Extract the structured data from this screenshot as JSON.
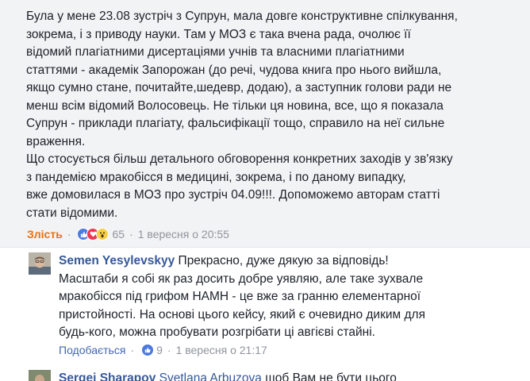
{
  "main_comment": {
    "lines": [
      "Була у мене 23.08 зустріч з Супрун, мала довге конструктивне спілкування,",
      "зокрема, і з приводу науки. Там у МОЗ є така вчена рада, очолює її",
      "відомий плагіатними дисертаціями учнів та власними плагіатними",
      "статтями - академік Запорожан (до речі, чудова книга про нього вийшла,",
      "якщо сумно стане, почитайте,шедевр, додаю), а заступник голови ради не",
      "менш всім відомий Волосовець. Не тільки ця новина, все, що я показала",
      "Супрун - приклади плагіату, фальсифікації тощо, справило на неї сильне",
      "враження.",
      "Що стосується більш детального обговорення конкретних заходів у зв'язку",
      "з пандемією мракобісся в медицині, зокрема, і по даному випадку,",
      "вже домовилася в МОЗ про зустріч 04.09!!!. Допоможемо авторам статті",
      "стати відомими."
    ],
    "action_label": "Злість",
    "separator": "·",
    "reaction_count": "65",
    "timestamp": "1 вересня о 20:55",
    "reaction_icons": [
      "like-icon",
      "love-icon",
      "wow-icon"
    ]
  },
  "reply": {
    "author": "Semen Yesylevskyy",
    "lines": [
      "Прекрасно, дуже дякую за відповідь!",
      "Масштаби я собі як раз досить добре уявляю, але таке зухвале",
      "мракобісся під грифом НАМН - це вже за гранню елементарної",
      "пристойності. На основі цього кейсу, який є очевидно диким для",
      "будь-кого, можна пробувати розгрібати ці авгієві стайні."
    ],
    "first_line_rest": "Прекрасно, дуже дякую за відповідь!",
    "action_label": "Подобається",
    "separator": "·",
    "reaction_count": "9",
    "timestamp": "1 вересня о 21:17"
  },
  "next_comment": {
    "author": "Sergei Sharapov",
    "tagged": "Svetlana Arbuzova",
    "text_start": " щоб Вам не бути цього"
  },
  "colors": {
    "comment_bg": "#f2f3f5",
    "link_blue": "#365899",
    "angry_orange": "#e9710f",
    "meta_grey": "#90949c"
  }
}
